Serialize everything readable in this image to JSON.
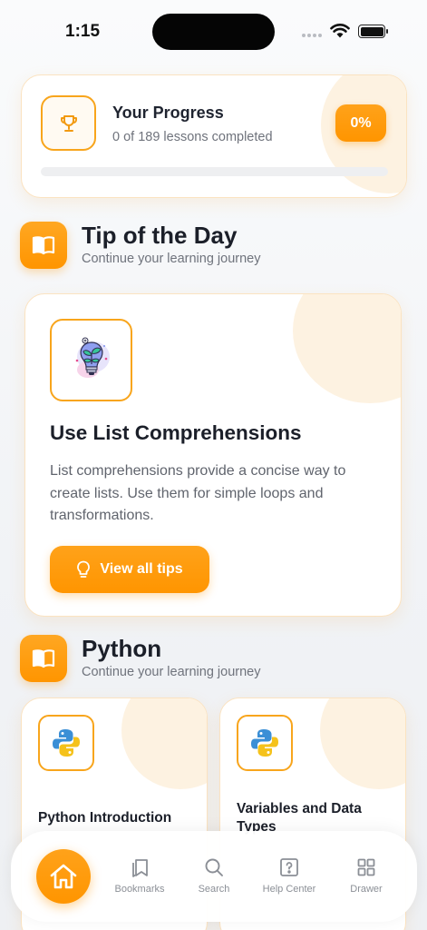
{
  "status_bar": {
    "time": "1:15"
  },
  "progress": {
    "title": "Your Progress",
    "subtitle": "0 of 189 lessons completed",
    "percent_label": "0%",
    "fraction": 0
  },
  "tip_section": {
    "title": "Tip of the Day",
    "subtitle": "Continue your learning journey"
  },
  "tip_card": {
    "title": "Use List Comprehensions",
    "body": "List comprehensions provide a concise way to create lists. Use them for simple loops and transformations.",
    "button_label": "View all tips"
  },
  "python_section": {
    "title": "Python",
    "subtitle": "Continue your learning journey"
  },
  "lessons": [
    {
      "title": "Python Introduction",
      "icon": "python-logo-icon"
    },
    {
      "title": "Variables and Data Types",
      "icon": "python-logo-icon"
    }
  ],
  "bottom_nav": {
    "items": [
      {
        "label": "Home",
        "icon": "home-icon"
      },
      {
        "label": "Bookmarks",
        "icon": "bookmark-icon"
      },
      {
        "label": "Search",
        "icon": "search-icon"
      },
      {
        "label": "Help Center",
        "icon": "help-icon"
      },
      {
        "label": "Drawer",
        "icon": "grid-icon"
      }
    ]
  },
  "colors": {
    "accent": "#ff9500",
    "card_border": "#fbe3c1",
    "text_primary": "#1b1f29",
    "text_secondary": "#6f737c"
  }
}
